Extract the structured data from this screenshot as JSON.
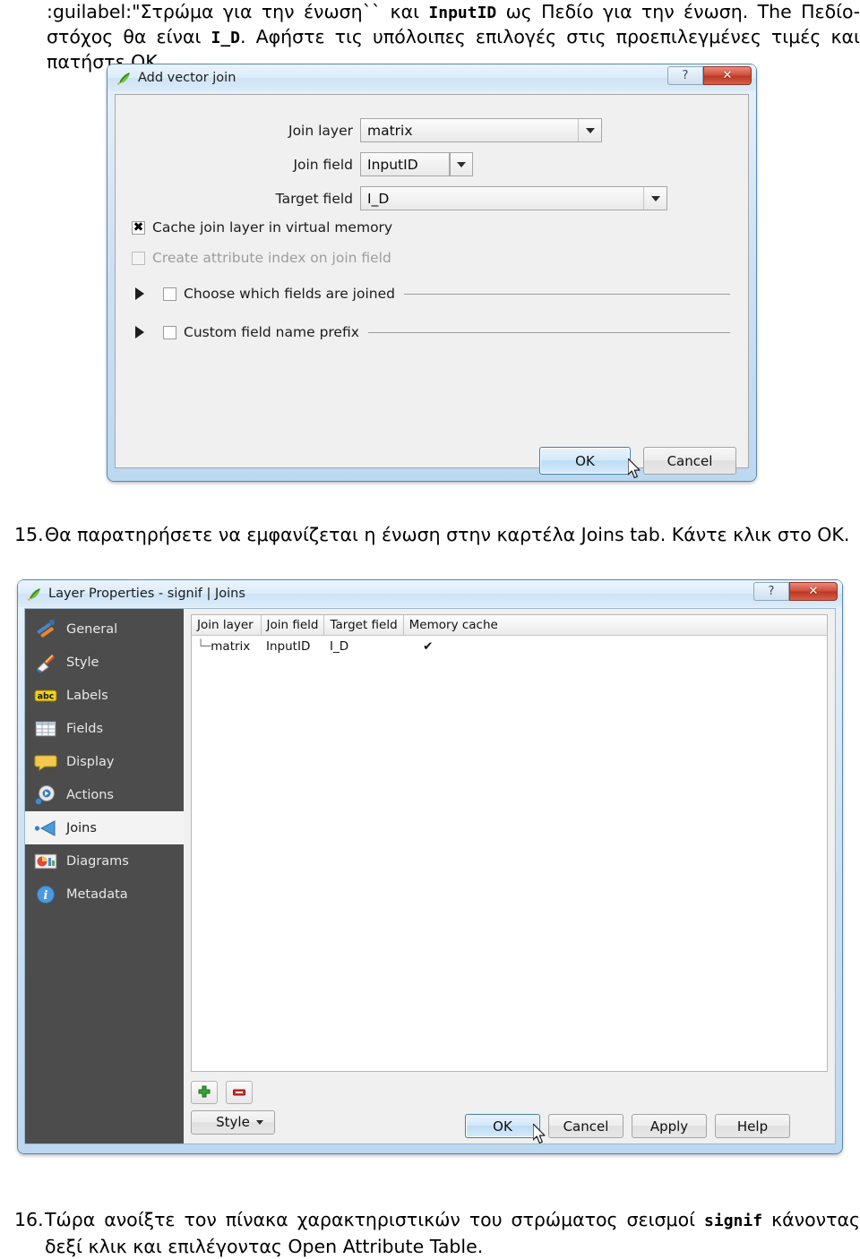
{
  "document": {
    "top_paragraph": {
      "part1": ":guilabel:\"Στρώμα για την ένωση``",
      "part2": " και ",
      "code1": "InputID",
      "part3": " ως Πεδίο για την ένωση. The Πεδίο-στόχος θα είναι ",
      "code2": "I_D",
      "part4": ". Αφήστε τις υπόλοιπες επιλογές στις προεπιλεγμένες τιμές και πατήστε ΟΚ."
    },
    "step15": {
      "number": "15.",
      "text": "Θα παρατηρήσετε να εμφανίζεται η ένωση στην καρτέλα Joins tab. Κάντε κλικ στο ΟΚ."
    },
    "step16": {
      "number": "16.",
      "text_before": "Τώρα ανοίξτε τον πίνακα χαρακτηριστικών του στρώματος σεισμοί ",
      "code": "signif",
      "text_after": " κάνοντας δεξί κλικ και επιλέγοντας Open Attribute Table."
    }
  },
  "add_vector_join_dialog": {
    "title": "Add vector join",
    "icon": "qgis-leaf-icon",
    "titlebar_buttons": {
      "help": "?",
      "close": "✕"
    },
    "fields": [
      {
        "label": "Join layer",
        "value": "matrix",
        "name": "join-layer"
      },
      {
        "label": "Join field",
        "value": "InputID",
        "name": "join-field"
      },
      {
        "label": "Target field",
        "value": "I_D",
        "name": "target-field"
      }
    ],
    "checkboxes": [
      {
        "label": "Cache join layer in virtual memory",
        "checked": true,
        "enabled": true,
        "mark": "✖"
      },
      {
        "label": "Create attribute index on join field",
        "checked": false,
        "enabled": false,
        "mark": ""
      }
    ],
    "collapsible": [
      {
        "label": "Choose which fields are joined",
        "checked": false
      },
      {
        "label": "Custom field name prefix",
        "checked": false
      }
    ],
    "buttons": {
      "ok": "OK",
      "cancel": "Cancel"
    }
  },
  "layer_properties_dialog": {
    "title": "Layer Properties - signif | Joins",
    "icon": "qgis-leaf-icon",
    "titlebar_buttons": {
      "help": "?",
      "close": "✕"
    },
    "sidebar": {
      "items": [
        {
          "label": "General",
          "icon": "tools-icon",
          "active": false
        },
        {
          "label": "Style",
          "icon": "brush-icon",
          "active": false
        },
        {
          "label": "Labels",
          "icon": "abc-icon",
          "active": false
        },
        {
          "label": "Fields",
          "icon": "table-icon",
          "active": false
        },
        {
          "label": "Display",
          "icon": "speech-bubble-icon",
          "active": false
        },
        {
          "label": "Actions",
          "icon": "gear-play-icon",
          "active": false
        },
        {
          "label": "Joins",
          "icon": "join-arrow-icon",
          "active": true
        },
        {
          "label": "Diagrams",
          "icon": "pie-chart-icon",
          "active": false
        },
        {
          "label": "Metadata",
          "icon": "info-icon",
          "active": false
        }
      ]
    },
    "joins_table": {
      "columns": [
        "Join layer",
        "Join field",
        "Target field",
        "Memory cache"
      ],
      "rows": [
        {
          "join_layer": "matrix",
          "join_field": "InputID",
          "target_field": "I_D",
          "memory_cache": "✔"
        }
      ]
    },
    "toolbar": {
      "add": "+",
      "remove": "–"
    },
    "buttons": {
      "style": "Style",
      "ok": "OK",
      "cancel": "Cancel",
      "apply": "Apply",
      "help": "Help"
    }
  },
  "colors": {
    "titlebar_blue": "#cde3f6",
    "close_red": "#cf4a36",
    "sidebar_dark": "#4c4c4c",
    "default_button_border": "#3c7fb1",
    "accent_green": "#33a532",
    "accent_red": "#d32a2a"
  }
}
